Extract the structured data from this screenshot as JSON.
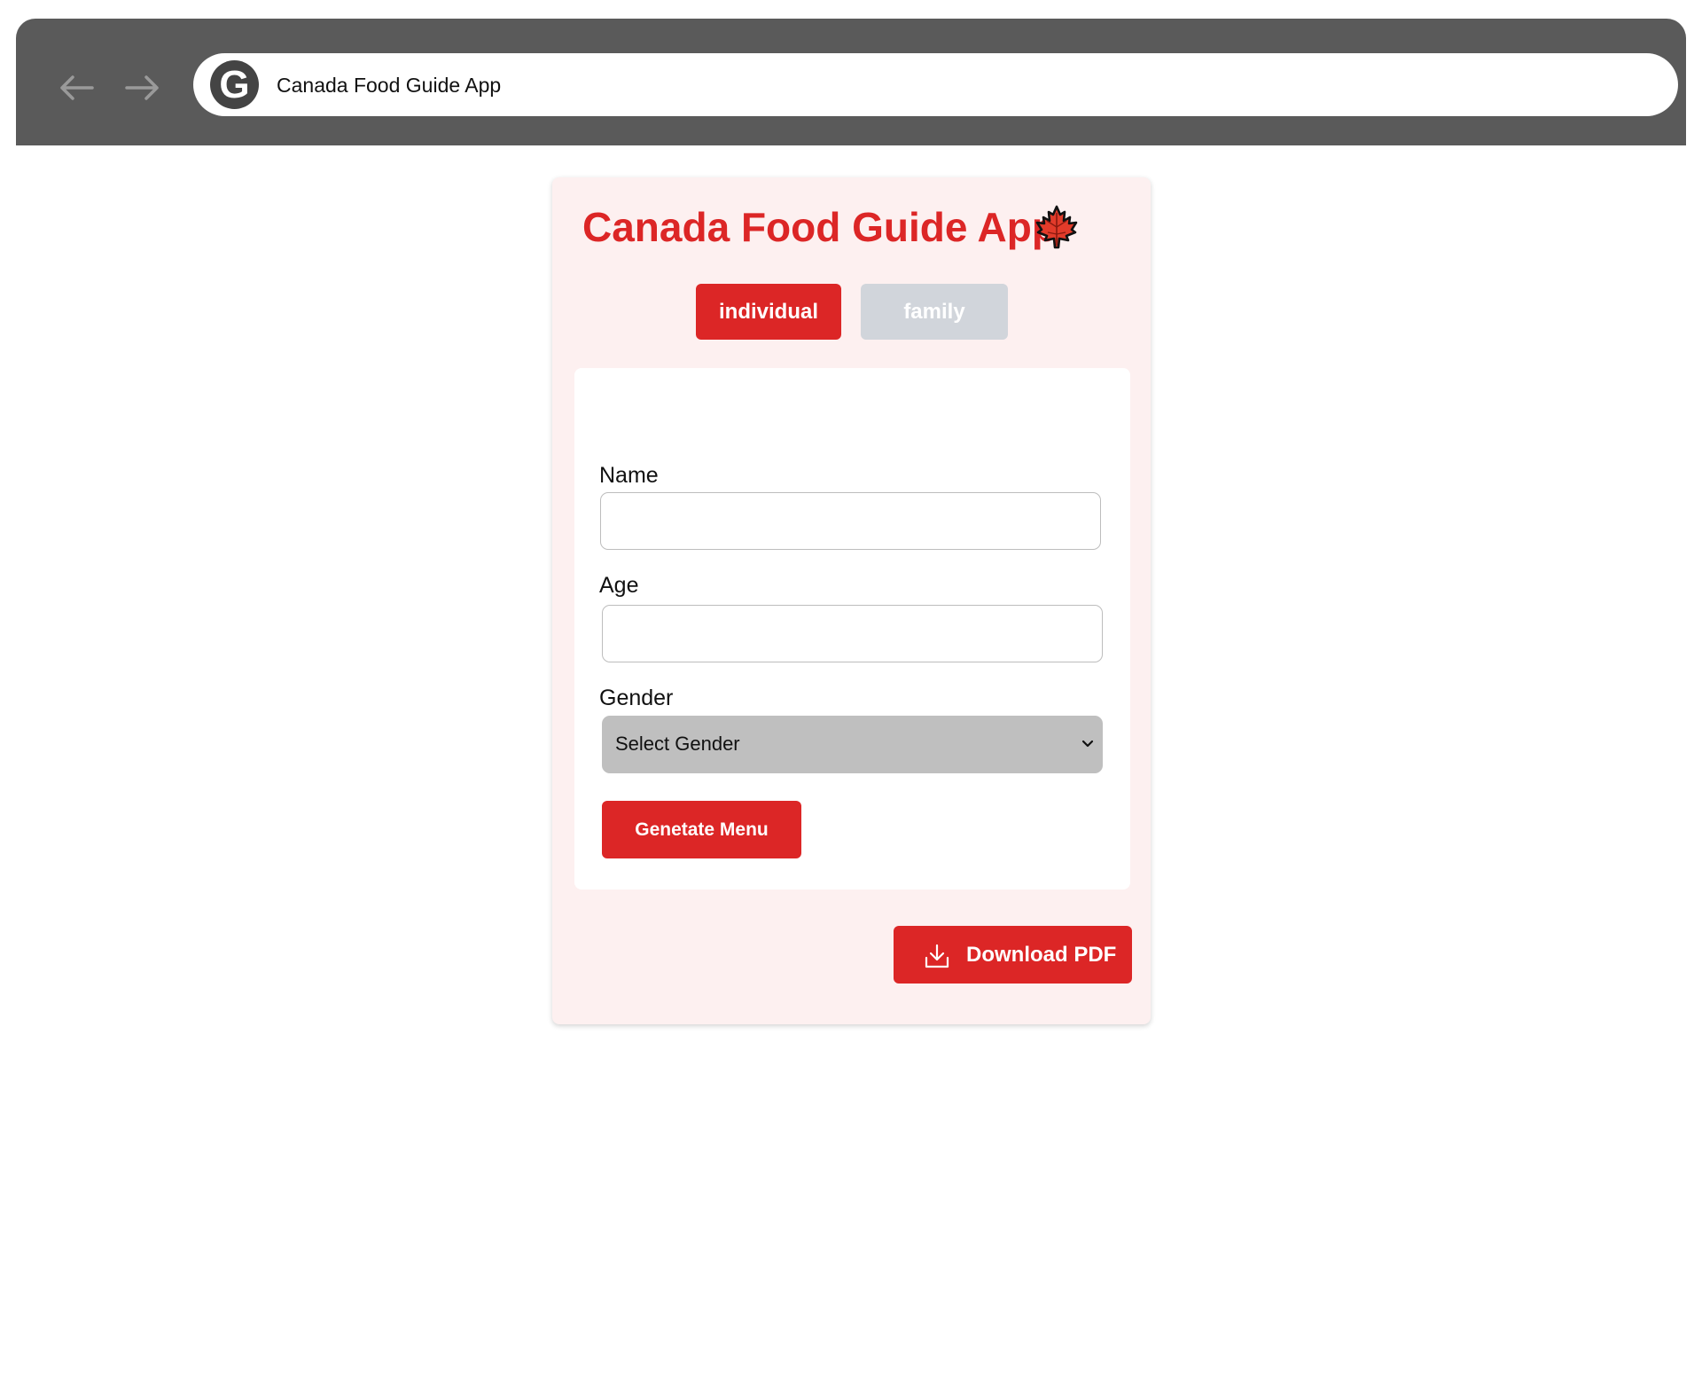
{
  "browser": {
    "site_icon_letter": "G",
    "address_text": "Canada Food Guide App",
    "icons": {
      "back": "arrow-left-icon",
      "forward": "arrow-right-icon"
    }
  },
  "app": {
    "title": "Canada Food Guide App",
    "title_icon": "maple-leaf-icon",
    "tabs": [
      {
        "label": "individual",
        "active": true
      },
      {
        "label": "family",
        "active": false
      }
    ],
    "form": {
      "name_label": "Name",
      "name_value": "",
      "age_label": "Age",
      "age_value": "",
      "gender_label": "Gender",
      "gender_selected": "Select Gender",
      "generate_button": "Genetate Menu"
    },
    "download_button": "Download PDF",
    "download_icon": "download-icon"
  },
  "colors": {
    "accent": "#dc2626",
    "inactive_tab": "#d1d5db",
    "card_background": "#fdf0f0",
    "browser_chrome": "#5a5a5a",
    "select_background": "#bfbfbf"
  }
}
